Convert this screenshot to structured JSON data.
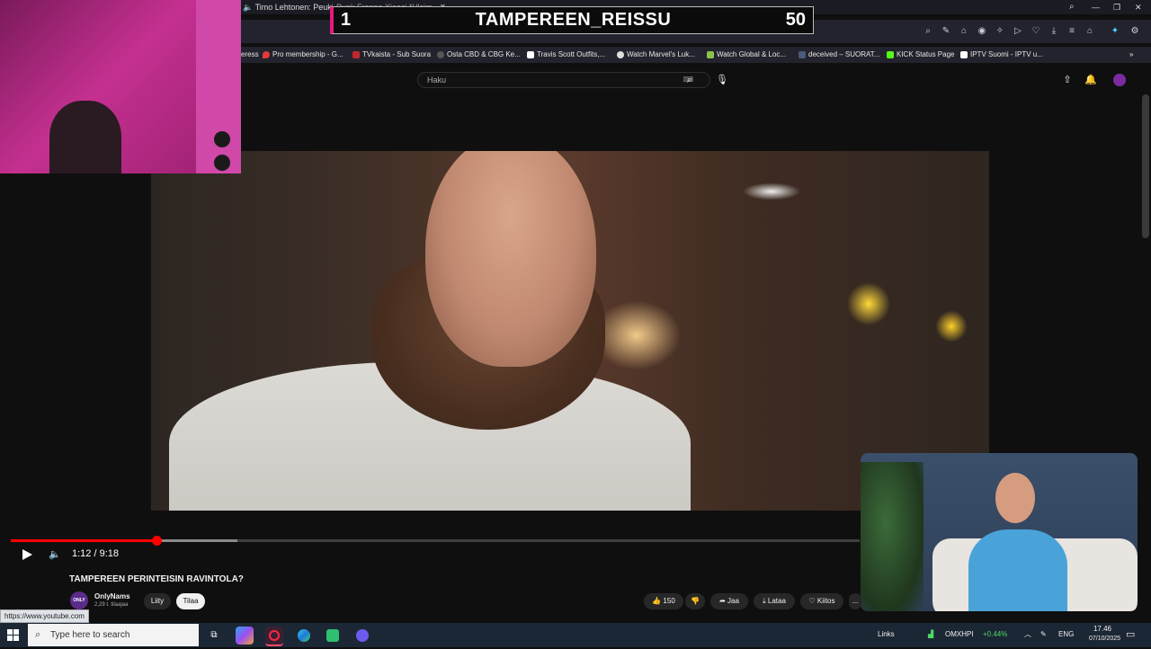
{
  "browser": {
    "tabs": [
      {
        "label": "Timo Lehtonen: Peuki"
      },
      {
        "label": "Punk Frappo Xiaozi *Vlcim"
      }
    ],
    "bookmarks": [
      {
        "label": "eress"
      },
      {
        "label": "Pro membership - G..."
      },
      {
        "label": "TVkaista - Sub Suora"
      },
      {
        "label": "Osta CBD & CBG Ke..."
      },
      {
        "label": "Travis Scott Outfits,..."
      },
      {
        "label": "Watch Marvel's Luk..."
      },
      {
        "label": "Watch Global & Loc..."
      },
      {
        "label": "deceived – SUORAT..."
      },
      {
        "label": "KICK Status Page"
      },
      {
        "label": "IPTV Suomi - IPTV u..."
      }
    ],
    "status_url": "https://www.youtube.com"
  },
  "overlay": {
    "left_value": "1",
    "title": "TAMPEREEN_REISSU",
    "right_value": "50",
    "accent": "#e5197e"
  },
  "youtube": {
    "search_placeholder": "Haku",
    "player": {
      "time": "1:12 / 9:18",
      "played_fraction": 0.172,
      "buffered_fraction": 0.267
    },
    "video": {
      "title": "TAMPEREEN PERINTEISIN RAVINTOLA?",
      "channel_avatar_text": "ONLY",
      "channel_name": "OnlyNams",
      "channel_subs": "2,29 t. tilaajaa",
      "join_label": "Liity",
      "subscribe_label": "Tilaa",
      "like_count": "150",
      "share_label": "Jaa",
      "download_label": "Lataa",
      "thanks_label": "Kiitos",
      "more_label": "..."
    }
  },
  "taskbar": {
    "search_placeholder": "Type here to search",
    "links_label": "Links",
    "stock_name": "OMXHPI",
    "stock_change": "+0.44%",
    "language": "ENG",
    "time": "17.46",
    "date": "07/10/2025",
    "colors": {
      "stock_up": "#4cd964"
    }
  }
}
